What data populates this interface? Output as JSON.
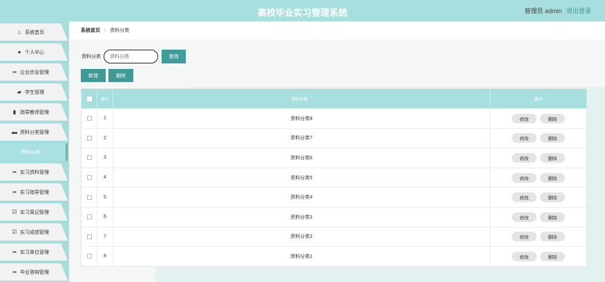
{
  "header": {
    "title": "高校毕业实习管理系统",
    "user": "管理员 admin",
    "logout": "退出登录"
  },
  "sidebar": {
    "items": [
      {
        "label": "系统首页",
        "icon": "home-icon",
        "glyph": "⌂"
      },
      {
        "label": "个人中心",
        "icon": "user-icon",
        "glyph": "●"
      },
      {
        "label": "企业信息管理",
        "icon": "grid-icon",
        "glyph": "▪▪"
      },
      {
        "label": "学生管理",
        "icon": "briefcase-icon",
        "glyph": "▰"
      },
      {
        "label": "指导教师管理",
        "icon": "clipboard-icon",
        "glyph": "▮"
      },
      {
        "label": "资料分类管理",
        "icon": "comment-icon",
        "glyph": "▬"
      },
      {
        "label": "资料分类",
        "icon": "",
        "glyph": ""
      },
      {
        "label": "实习资料管理",
        "icon": "grid-icon",
        "glyph": "▪▪"
      },
      {
        "label": "实习指导管理",
        "icon": "grid-icon",
        "glyph": "▪▪"
      },
      {
        "label": "实习周记管理",
        "icon": "check-square-icon",
        "glyph": "☑"
      },
      {
        "label": "实习成绩管理",
        "icon": "check-square-icon",
        "glyph": "☑"
      },
      {
        "label": "实习单位管理",
        "icon": "grid-icon",
        "glyph": "▪▪"
      },
      {
        "label": "毕业答辩管理",
        "icon": "grid-icon",
        "glyph": "▪▪"
      }
    ],
    "active_index": 6
  },
  "breadcrumb": {
    "home": "系统首页",
    "separator": "⁝",
    "current": "资料分类"
  },
  "search": {
    "label": "资料分类",
    "placeholder": "资料分类",
    "button": "查询"
  },
  "actions": {
    "add": "新增",
    "delete": "删除"
  },
  "table": {
    "headers": {
      "index": "索引",
      "name": "资料分类",
      "sort_arrow": "↕",
      "operation": "操作"
    },
    "rows": [
      {
        "index": "1",
        "name": "资料分类8"
      },
      {
        "index": "2",
        "name": "资料分类7"
      },
      {
        "index": "3",
        "name": "资料分类6"
      },
      {
        "index": "4",
        "name": "资料分类5"
      },
      {
        "index": "5",
        "name": "资料分类4"
      },
      {
        "index": "6",
        "name": "资料分类3"
      },
      {
        "index": "7",
        "name": "资料分类2"
      },
      {
        "index": "8",
        "name": "资料分类1"
      }
    ],
    "row_edit": "修改",
    "row_delete": "删除"
  },
  "colors": {
    "accent": "#a7dfdf",
    "button": "#419b98"
  }
}
